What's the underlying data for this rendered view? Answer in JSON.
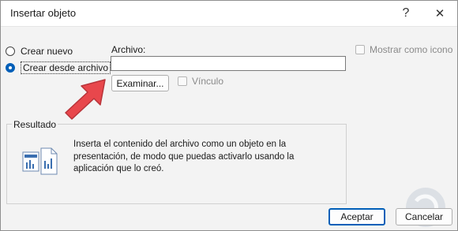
{
  "window": {
    "title": "Insertar objeto",
    "help_glyph": "?",
    "close_glyph": "✕"
  },
  "options": {
    "crear_nuevo": "Crear nuevo",
    "crear_desde_archivo": "Crear desde archivo",
    "selected": "crear_desde_archivo"
  },
  "file": {
    "label": "Archivo:",
    "value": "",
    "browse_label": "Examinar..."
  },
  "vinculo": {
    "label": "Vínculo",
    "checked": false,
    "enabled": false
  },
  "mostrar_icono": {
    "label": "Mostrar como icono",
    "checked": false,
    "enabled": false
  },
  "resultado": {
    "label": "Resultado",
    "text": "Inserta el contenido del archivo como un objeto en la presentación, de modo que puedas activarlo usando la aplicación que lo creó."
  },
  "buttons": {
    "ok": "Aceptar",
    "cancel": "Cancelar"
  },
  "colors": {
    "accent": "#005fb8",
    "arrow": "#e8474c"
  }
}
